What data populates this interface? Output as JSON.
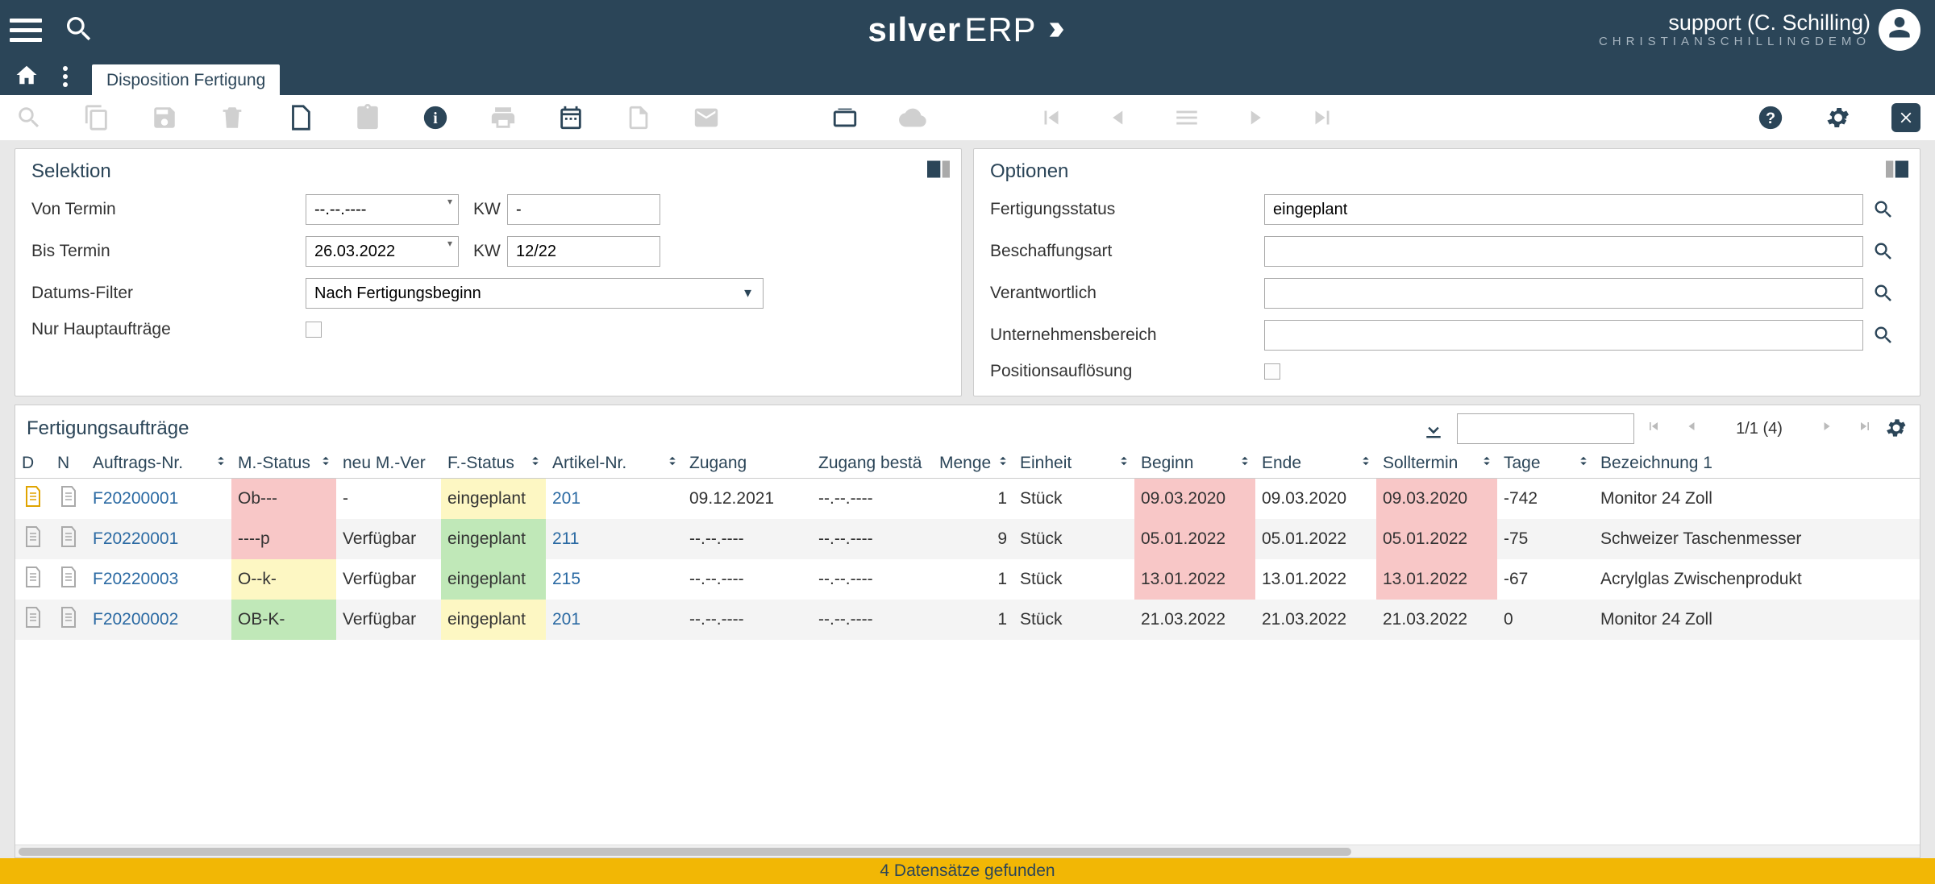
{
  "brand": {
    "bold": "sılver",
    "thin": "ERP"
  },
  "user": {
    "name": "support (C. Schilling)",
    "subtitle": "CHRISTIANSCHILLINGDEMO"
  },
  "tab": {
    "label": "Disposition Fertigung"
  },
  "selektion": {
    "title": "Selektion",
    "von_termin_label": "Von Termin",
    "von_termin_value": "--.--.----",
    "kw_label": "KW",
    "von_kw_value": "-",
    "bis_termin_label": "Bis Termin",
    "bis_termin_value": "26.03.2022",
    "bis_kw_value": "12/22",
    "datums_filter_label": "Datums-Filter",
    "datums_filter_value": "Nach Fertigungsbeginn",
    "nur_haupt_label": "Nur Hauptaufträge"
  },
  "optionen": {
    "title": "Optionen",
    "fertigungsstatus_label": "Fertigungsstatus",
    "fertigungsstatus_value": "eingeplant",
    "beschaffungsart_label": "Beschaffungsart",
    "beschaffungsart_value": "",
    "verantwortlich_label": "Verantwortlich",
    "verantwortlich_value": "",
    "unternehmensbereich_label": "Unternehmensbereich",
    "unternehmensbereich_value": "",
    "positionsaufloesung_label": "Positionsauflösung"
  },
  "table": {
    "title": "Fertigungsaufträge",
    "pager": "1/1 (4)",
    "columns": [
      "D",
      "N",
      "Auftrags-Nr.",
      "M.-Status",
      "neu M.-Ver",
      "F.-Status",
      "Artikel-Nr.",
      "Zugang",
      "Zugang bestä",
      "Menge",
      "Einheit",
      "Beginn",
      "Ende",
      "Solltermin",
      "Tage",
      "Bezeichnung 1"
    ],
    "rows": [
      {
        "doc": "yellow",
        "auftrag": "F20200001",
        "mstatus": "Ob---",
        "mstatus_bg": "red",
        "neu": "-",
        "fstatus": "eingeplant",
        "fstatus_bg": "yellow",
        "artikel": "201",
        "zugang": "09.12.2021",
        "zugang_best": "--.--.----",
        "menge": "1",
        "einheit": "Stück",
        "beginn": "09.03.2020",
        "beginn_bg": "red",
        "ende": "09.03.2020",
        "soll": "09.03.2020",
        "soll_bg": "red",
        "tage": "-742",
        "bez": "Monitor 24 Zoll"
      },
      {
        "doc": "gray",
        "auftrag": "F20220001",
        "mstatus": "----p",
        "mstatus_bg": "red",
        "neu": "Verfügbar",
        "fstatus": "eingeplant",
        "fstatus_bg": "green",
        "artikel": "211",
        "zugang": "--.--.----",
        "zugang_best": "--.--.----",
        "menge": "9",
        "einheit": "Stück",
        "beginn": "05.01.2022",
        "beginn_bg": "red",
        "ende": "05.01.2022",
        "soll": "05.01.2022",
        "soll_bg": "red",
        "tage": "-75",
        "bez": "Schweizer Taschenmesser"
      },
      {
        "doc": "gray",
        "auftrag": "F20220003",
        "mstatus": "O--k-",
        "mstatus_bg": "yellow",
        "neu": "Verfügbar",
        "fstatus": "eingeplant",
        "fstatus_bg": "green",
        "artikel": "215",
        "zugang": "--.--.----",
        "zugang_best": "--.--.----",
        "menge": "1",
        "einheit": "Stück",
        "beginn": "13.01.2022",
        "beginn_bg": "red",
        "ende": "13.01.2022",
        "soll": "13.01.2022",
        "soll_bg": "red",
        "tage": "-67",
        "bez": "Acrylglas Zwischenprodukt"
      },
      {
        "doc": "gray",
        "auftrag": "F20200002",
        "mstatus": "OB-K-",
        "mstatus_bg": "green",
        "neu": "Verfügbar",
        "fstatus": "eingeplant",
        "fstatus_bg": "yellow",
        "artikel": "201",
        "zugang": "--.--.----",
        "zugang_best": "--.--.----",
        "menge": "1",
        "einheit": "Stück",
        "beginn": "21.03.2022",
        "beginn_bg": "",
        "ende": "21.03.2022",
        "soll": "21.03.2022",
        "soll_bg": "",
        "tage": "0",
        "bez": "Monitor 24 Zoll"
      }
    ]
  },
  "status": "4 Datensätze gefunden"
}
